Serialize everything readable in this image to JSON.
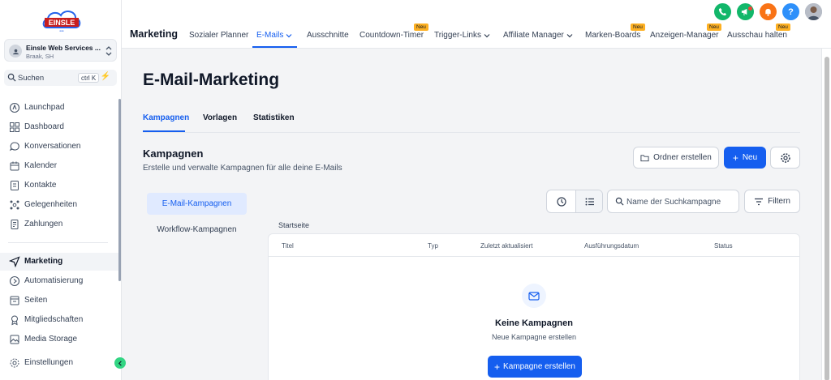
{
  "colors": {
    "primary": "#155eef",
    "neu_badge": "#fdb022",
    "phone": "#12b76a",
    "megaphone": "#12b76a",
    "bell": "#f97316",
    "help": "#2e90fa"
  },
  "sidebar": {
    "logo_text": "EINSLE",
    "location": {
      "name": "Einsle Web Services ...",
      "sub": "Braak, SH"
    },
    "search": {
      "label": "Suchen",
      "shortcut": "ctrl K"
    },
    "items": [
      {
        "label": "Launchpad",
        "icon": "rocket-icon"
      },
      {
        "label": "Dashboard",
        "icon": "dashboard-grid-icon"
      },
      {
        "label": "Konversationen",
        "icon": "chat-bubble-icon"
      },
      {
        "label": "Kalender",
        "icon": "calendar-icon"
      },
      {
        "label": "Kontakte",
        "icon": "contacts-icon"
      },
      {
        "label": "Gelegenheiten",
        "icon": "opportunities-icon"
      },
      {
        "label": "Zahlungen",
        "icon": "payments-icon"
      },
      {
        "label": "Marketing",
        "icon": "send-icon"
      },
      {
        "label": "Automatisierung",
        "icon": "automation-icon"
      },
      {
        "label": "Seiten",
        "icon": "pages-icon"
      },
      {
        "label": "Mitgliedschaften",
        "icon": "membership-icon"
      },
      {
        "label": "Media Storage",
        "icon": "media-icon"
      }
    ],
    "settings_label": "Einstellungen"
  },
  "topbar": {
    "title": "Marketing",
    "nav": [
      {
        "label": "Sozialer Planner"
      },
      {
        "label": "E-Mails"
      },
      {
        "label": "Ausschnitte"
      },
      {
        "label": "Countdown-Timer"
      },
      {
        "label": "Trigger-Links"
      },
      {
        "label": "Affiliate Manager"
      },
      {
        "label": "Marken-Boards"
      },
      {
        "label": "Anzeigen-Manager"
      },
      {
        "label": "Ausschau halten"
      }
    ],
    "badge_label": "Neu"
  },
  "main": {
    "page_title": "E-Mail-Marketing",
    "tabs": [
      {
        "label": "Kampagnen"
      },
      {
        "label": "Vorlagen"
      },
      {
        "label": "Statistiken"
      }
    ],
    "section_title": "Kampagnen",
    "section_subtitle": "Erstelle und verwalte Kampagnen für alle deine E-Mails",
    "create_folder_label": "Ordner erstellen",
    "new_label": "Neu",
    "side_tabs": [
      {
        "label": "E-Mail-Kampagnen"
      },
      {
        "label": "Workflow-Kampagnen"
      }
    ],
    "search_placeholder": "Name der Suchkampagne",
    "filter_label": "Filtern",
    "folder_label": "Startseite",
    "table": {
      "columns": [
        "Titel",
        "Typ",
        "Zuletzt aktualisiert",
        "Ausführungsdatum",
        "Status"
      ],
      "empty_title": "Keine Kampagnen",
      "empty_subtitle": "Neue Kampagne erstellen",
      "empty_button": "Kampagne erstellen"
    }
  }
}
